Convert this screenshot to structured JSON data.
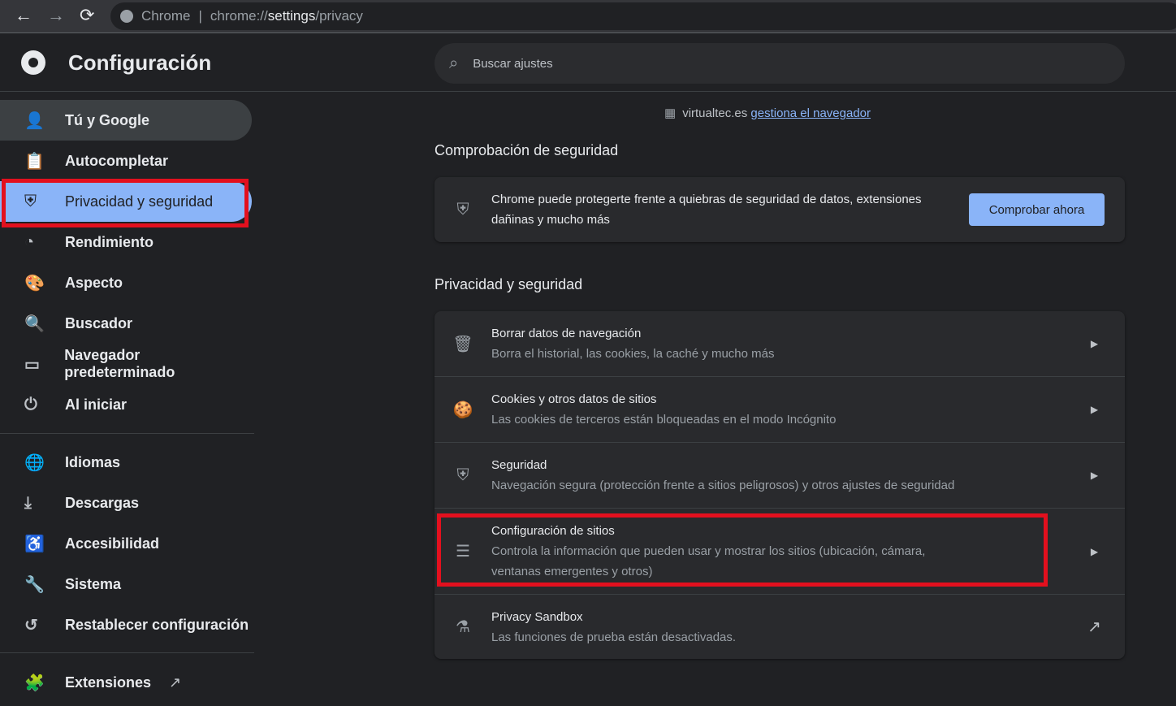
{
  "browser": {
    "back": "←",
    "forward": "→",
    "reload": "⟳",
    "site_label": "Chrome",
    "url_prefix": "chrome://",
    "url_host": "settings",
    "url_path": "/privacy"
  },
  "header": {
    "title": "Configuración",
    "search_placeholder": "Buscar ajustes"
  },
  "sidebar": {
    "items": [
      {
        "label": "Tú y Google",
        "icon": "👤"
      },
      {
        "label": "Autocompletar",
        "icon": "📋"
      },
      {
        "label": "Privacidad y seguridad",
        "icon": "⛨"
      },
      {
        "label": "Rendimiento",
        "icon": "◔"
      },
      {
        "label": "Aspecto",
        "icon": "🎨"
      },
      {
        "label": "Buscador",
        "icon": "🔍"
      },
      {
        "label": "Navegador predeterminado",
        "icon": "▭"
      },
      {
        "label": "Al iniciar",
        "icon": "⏻"
      },
      {
        "label": "Idiomas",
        "icon": "🌐"
      },
      {
        "label": "Descargas",
        "icon": "⤓"
      },
      {
        "label": "Accesibilidad",
        "icon": "♿"
      },
      {
        "label": "Sistema",
        "icon": "🔧"
      },
      {
        "label": "Restablecer configuración",
        "icon": "↺"
      },
      {
        "label": "Extensiones",
        "icon": "🧩"
      }
    ],
    "external_icon": "↗"
  },
  "managed": {
    "domain": "virtualtec.es",
    "link": "gestiona el navegador"
  },
  "safety": {
    "heading": "Comprobación de seguridad",
    "text": "Chrome puede protegerte frente a quiebras de seguridad de datos, extensiones dañinas y mucho más",
    "button": "Comprobar ahora"
  },
  "privacy": {
    "heading": "Privacidad y seguridad",
    "rows": [
      {
        "title": "Borrar datos de navegación",
        "sub": "Borra el historial, las cookies, la caché y mucho más",
        "icon": "🗑"
      },
      {
        "title": "Cookies y otros datos de sitios",
        "sub": "Las cookies de terceros están bloqueadas en el modo Incógnito",
        "icon": "🍪"
      },
      {
        "title": "Seguridad",
        "sub": "Navegación segura (protección frente a sitios peligrosos) y otros ajustes de seguridad",
        "icon": "⛨"
      },
      {
        "title": "Configuración de sitios",
        "sub": "Controla la información que pueden usar y mostrar los sitios (ubicación, cámara, ventanas emergentes y otros)",
        "icon": "☰"
      },
      {
        "title": "Privacy Sandbox",
        "sub": "Las funciones de prueba están desactivadas.",
        "icon": "⚗"
      }
    ]
  },
  "colors": {
    "accent": "#8ab4f8",
    "highlight": "#e3101e",
    "background": "#202124",
    "card": "#292a2d"
  }
}
